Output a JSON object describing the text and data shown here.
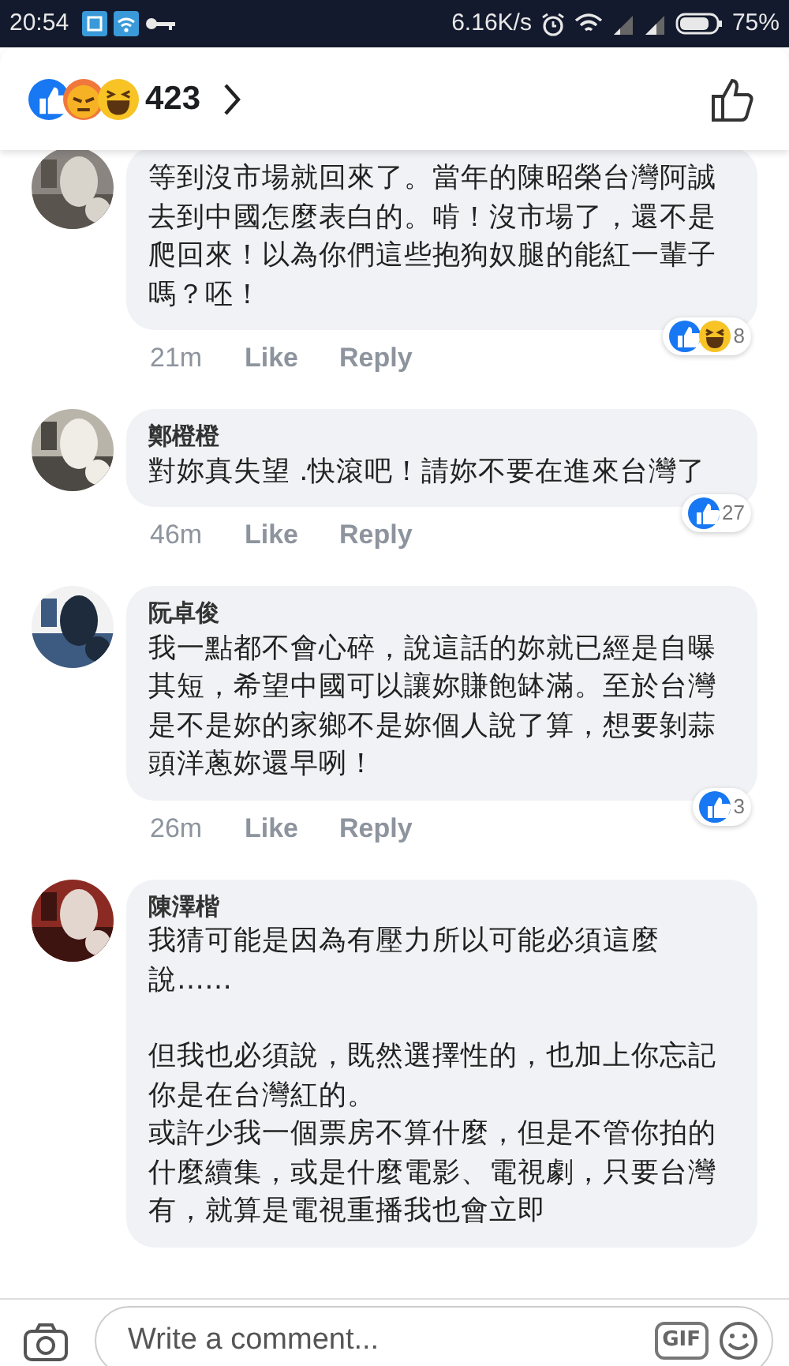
{
  "status_bar": {
    "time": "20:54",
    "speed": "6.16K/s",
    "battery": "75%"
  },
  "reactions_header": {
    "reactions": [
      {
        "kind": "like"
      },
      {
        "kind": "angry"
      },
      {
        "kind": "haha"
      }
    ],
    "count": "423"
  },
  "comments": [
    {
      "paragraphs": [
        [
          "等到沒市場就回來了。當年的陳昭榮台灣阿誠去到中國怎麼表白的。啃！沒市場了，還不是爬回來！以為你們這些抱狗奴腿的能紅一輩子嗎？呸！"
        ]
      ],
      "time": "21m",
      "actions": [
        "Like",
        "Reply"
      ],
      "reactions": [
        {
          "kind": "like"
        },
        {
          "kind": "haha"
        }
      ],
      "reaction_count": "8"
    },
    {
      "name": "鄭橙橙",
      "paragraphs": [
        [
          "對妳真失望 .快滾吧！請妳不要在進來台灣了"
        ]
      ],
      "time": "46m",
      "actions": [
        "Like",
        "Reply"
      ],
      "reactions": [
        {
          "kind": "like"
        }
      ],
      "reaction_count": "27"
    },
    {
      "name": "阮卓俊",
      "paragraphs": [
        [
          "我一點都不會心碎，說這話的妳就已經是自曝其短，希望中國可以讓妳賺飽缽滿。至於台灣是不是妳的家鄉不是妳個人說了算，想要剝蒜頭洋蔥妳還早咧！"
        ]
      ],
      "time": "26m",
      "actions": [
        "Like",
        "Reply"
      ],
      "reactions": [
        {
          "kind": "like"
        }
      ],
      "reaction_count": "3"
    },
    {
      "name": "陳澤楷",
      "paragraphs": [
        [
          "我猜可能是因為有壓力所以可能必須這麼說……"
        ],
        [
          "但我也必須說，既然選擇性的，也加上你忘記你是在台灣紅的。",
          "或許少我一個票房不算什麼，但是不管你拍的什麼續集，或是什麼電影、電視劇，只要台灣有，就算是電視重播我也會立即"
        ]
      ]
    }
  ],
  "composer": {
    "placeholder": "Write a comment...",
    "gif": "GIF"
  }
}
